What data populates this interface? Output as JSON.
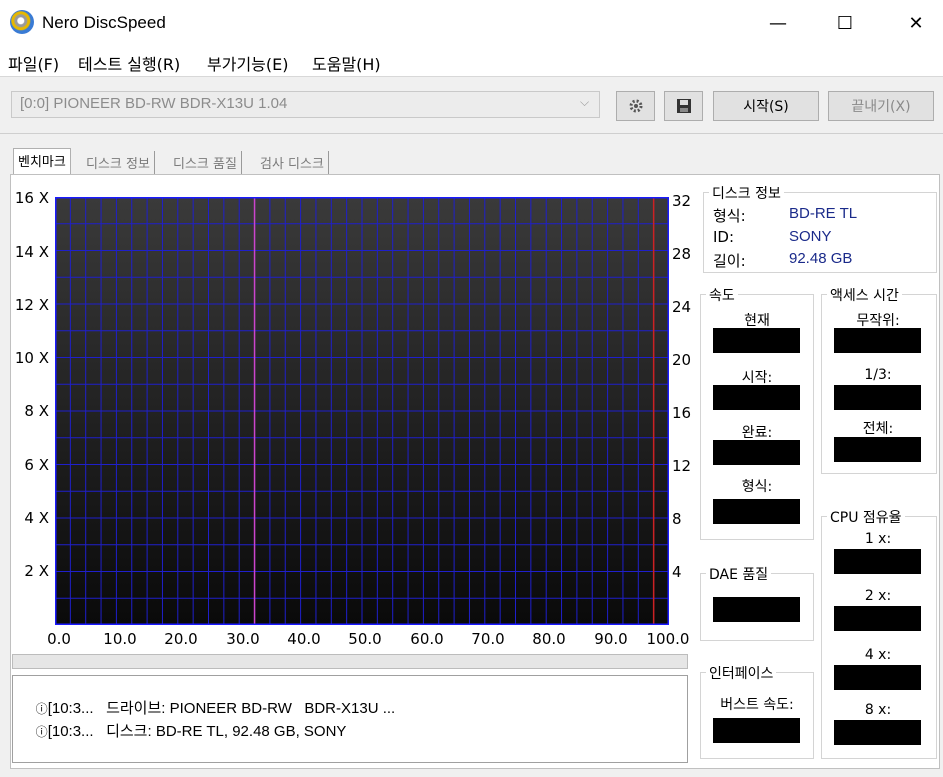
{
  "window": {
    "title": "Nero DiscSpeed",
    "minimize": "—",
    "maximize": "☐",
    "close": "✕"
  },
  "menu": [
    "파일(F)",
    "테스트 실행(R)",
    "부가기능(E)",
    "도움말(H)"
  ],
  "toolbar": {
    "drive": "[0:0]   PIONEER BD-RW   BDR-X13U 1.04",
    "start": "시작(S)",
    "exit": "끝내기(X)"
  },
  "tabs": [
    "벤치마크",
    "디스크 정보",
    "디스크 품질",
    "검사 디스크"
  ],
  "chart": {
    "left_ticks": [
      "16 X",
      "14 X",
      "12 X",
      "10 X",
      "8 X",
      "6 X",
      "4 X",
      "2 X"
    ],
    "right_ticks": [
      "32",
      "28",
      "24",
      "20",
      "16",
      "12",
      "8",
      "4"
    ],
    "x_ticks": [
      "0.0",
      "10.0",
      "20.0",
      "30.0",
      "40.0",
      "50.0",
      "60.0",
      "70.0",
      "80.0",
      "90.0",
      "100.0"
    ],
    "line_colors": {
      "grid": "#1f1fcc",
      "magenta": "#cc44cc",
      "red": "#cc2222"
    }
  },
  "chart_data": {
    "type": "line",
    "x_range": [
      0,
      100
    ],
    "left_range": [
      0,
      16
    ],
    "right_range": [
      0,
      32
    ],
    "x_ticks": [
      0,
      10,
      20,
      30,
      40,
      50,
      60,
      70,
      80,
      90,
      100
    ],
    "left_ticks": [
      2,
      4,
      6,
      8,
      10,
      12,
      14,
      16
    ],
    "right_ticks": [
      4,
      8,
      12,
      16,
      20,
      24,
      28,
      32
    ],
    "markers": [
      {
        "x": 32.5,
        "color": "#cc44cc"
      },
      {
        "x": 97.5,
        "color": "#cc2222"
      }
    ],
    "series": [],
    "grid": true
  },
  "log": [
    {
      "time": "[10:3...",
      "text": "드라이브: PIONEER BD-RW   BDR-X13U ..."
    },
    {
      "time": "[10:3...",
      "text": "디스크: BD-RE TL, 92.48 GB, SONY"
    }
  ],
  "disc_info": {
    "title": "디스크 정보",
    "rows": [
      {
        "label": "형식:",
        "value": "BD-RE TL"
      },
      {
        "label": "ID:",
        "value": "SONY"
      },
      {
        "label": "길이:",
        "value": "92.48 GB"
      }
    ]
  },
  "speed": {
    "title": "속도",
    "fields": [
      "현재",
      "시작:",
      "완료:",
      "형식:"
    ]
  },
  "access": {
    "title": "액세스 시간",
    "fields": [
      "무작위:",
      "1/3:",
      "전체:"
    ]
  },
  "cpu": {
    "title": "CPU 점유율",
    "fields": [
      "1 x:",
      "2 x:",
      "4 x:",
      "8 x:"
    ]
  },
  "dae": {
    "title": "DAE 품질"
  },
  "iface": {
    "title": "인터페이스",
    "burst": "버스트 속도:"
  }
}
